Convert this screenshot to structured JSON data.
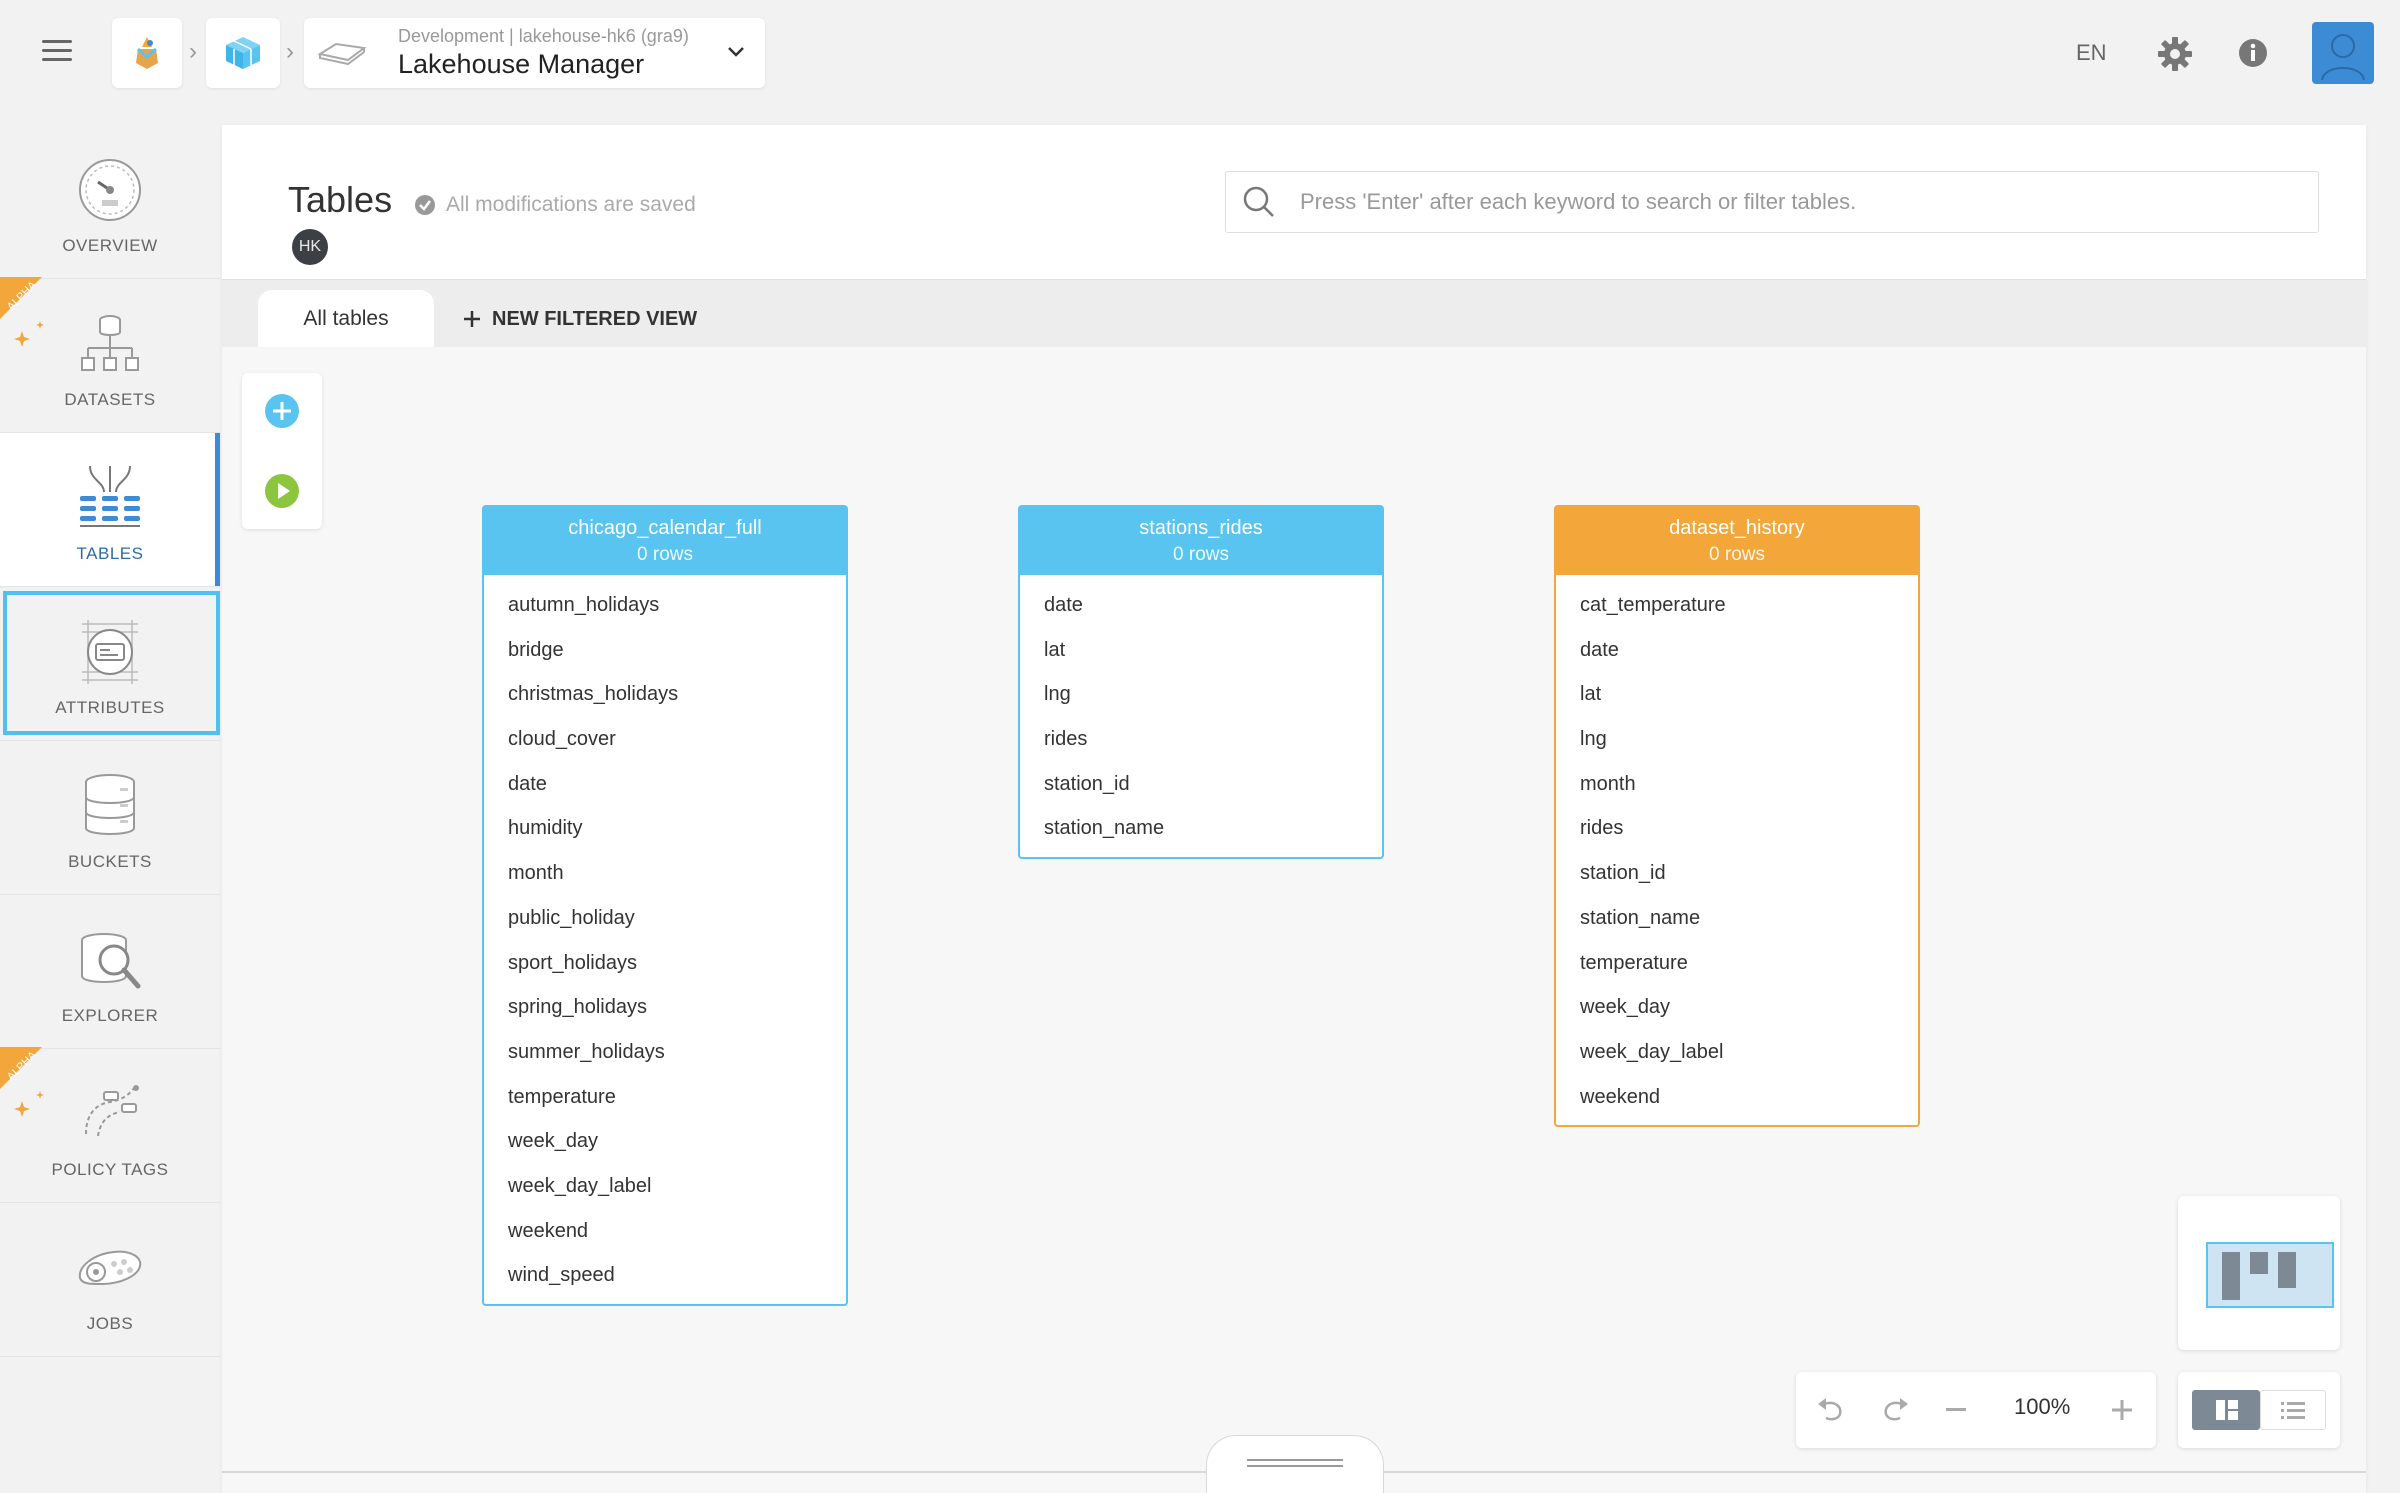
{
  "header": {
    "project_subtitle": "Development | lakehouse-hk6 (gra9)",
    "project_name": "Lakehouse Manager",
    "language": "EN"
  },
  "sidebar": {
    "items": [
      {
        "label": "OVERVIEW",
        "icon": "gauge-icon",
        "alpha": false,
        "active": false
      },
      {
        "label": "DATASETS",
        "icon": "dataset-tree-icon",
        "alpha": true,
        "active": false
      },
      {
        "label": "TABLES",
        "icon": "tables-icon",
        "alpha": false,
        "active": true
      },
      {
        "label": "ATTRIBUTES",
        "icon": "attributes-icon",
        "alpha": false,
        "active": false
      },
      {
        "label": "BUCKETS",
        "icon": "database-icon",
        "alpha": false,
        "active": false
      },
      {
        "label": "EXPLORER",
        "icon": "explorer-icon",
        "alpha": false,
        "active": false
      },
      {
        "label": "POLICY TAGS",
        "icon": "policy-tags-icon",
        "alpha": true,
        "active": false
      },
      {
        "label": "JOBS",
        "icon": "jobs-icon",
        "alpha": false,
        "active": false
      }
    ],
    "alpha_label": "ALPHA"
  },
  "page": {
    "title": "Tables",
    "saved_status": "All modifications are saved",
    "user_initials": "HK",
    "search_placeholder": "Press 'Enter' after each keyword to search or filter tables."
  },
  "tabs": {
    "all_tables": "All tables",
    "new_filtered_view": "NEW FILTERED VIEW"
  },
  "tables": [
    {
      "name": "chicago_calendar_full",
      "rows": "0 rows",
      "color": "#59c4ef",
      "fields": [
        "autumn_holidays",
        "bridge",
        "christmas_holidays",
        "cloud_cover",
        "date",
        "humidity",
        "month",
        "public_holiday",
        "sport_holidays",
        "spring_holidays",
        "summer_holidays",
        "temperature",
        "week_day",
        "week_day_label",
        "weekend",
        "wind_speed"
      ]
    },
    {
      "name": "stations_rides",
      "rows": "0 rows",
      "color": "#59c4ef",
      "fields": [
        "date",
        "lat",
        "lng",
        "rides",
        "station_id",
        "station_name"
      ]
    },
    {
      "name": "dataset_history",
      "rows": "0 rows",
      "color": "#f3a63a",
      "fields": [
        "cat_temperature",
        "date",
        "lat",
        "lng",
        "month",
        "rides",
        "station_id",
        "station_name",
        "temperature",
        "week_day",
        "week_day_label",
        "weekend"
      ]
    }
  ],
  "zoom": {
    "level": "100%"
  },
  "colors": {
    "accent_blue": "#59c4ef",
    "accent_orange": "#f3a63a",
    "highlight": "#4fc1ef",
    "play_green": "#8cc63f"
  }
}
